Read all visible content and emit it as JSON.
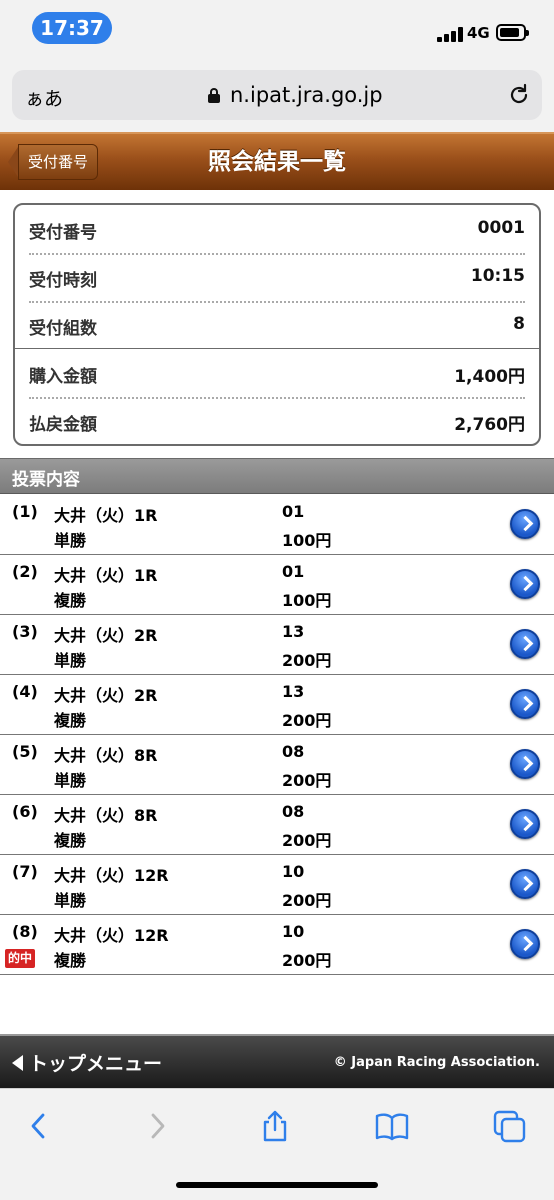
{
  "status_bar": {
    "time": "17:37",
    "network": "4G",
    "battery_level": 0.85
  },
  "browser": {
    "aa_label": "ぁあ",
    "domain": "n.ipat.jra.go.jp"
  },
  "header": {
    "back_label": "受付番号",
    "title": "照会結果一覧"
  },
  "summary": {
    "rows": [
      {
        "label": "受付番号",
        "value": "0001"
      },
      {
        "label": "受付時刻",
        "value": "10:15"
      },
      {
        "label": "受付組数",
        "value": "8"
      },
      {
        "label": "購入金額",
        "value": "1,400円"
      },
      {
        "label": "払戻金額",
        "value": "2,760円"
      }
    ]
  },
  "section": {
    "title": "投票内容"
  },
  "bets": [
    {
      "num": "(1)",
      "race": "大井（火）1R",
      "type": "単勝",
      "selection": "01",
      "amount": "100円",
      "hit": ""
    },
    {
      "num": "(2)",
      "race": "大井（火）1R",
      "type": "複勝",
      "selection": "01",
      "amount": "100円",
      "hit": ""
    },
    {
      "num": "(3)",
      "race": "大井（火）2R",
      "type": "単勝",
      "selection": "13",
      "amount": "200円",
      "hit": ""
    },
    {
      "num": "(4)",
      "race": "大井（火）2R",
      "type": "複勝",
      "selection": "13",
      "amount": "200円",
      "hit": ""
    },
    {
      "num": "(5)",
      "race": "大井（火）8R",
      "type": "単勝",
      "selection": "08",
      "amount": "200円",
      "hit": ""
    },
    {
      "num": "(6)",
      "race": "大井（火）8R",
      "type": "複勝",
      "selection": "08",
      "amount": "200円",
      "hit": ""
    },
    {
      "num": "(7)",
      "race": "大井（火）12R",
      "type": "単勝",
      "selection": "10",
      "amount": "200円",
      "hit": ""
    },
    {
      "num": "(8)",
      "race": "大井（火）12R",
      "type": "複勝",
      "selection": "10",
      "amount": "200円",
      "hit": "的中"
    }
  ],
  "footer": {
    "top_menu": "トップメニュー",
    "copyright": "© Japan Racing Association."
  },
  "icons": {
    "back": "chevron-left-icon",
    "forward": "chevron-right-icon",
    "share": "share-icon",
    "bookmarks": "book-icon",
    "tabs": "tabs-icon",
    "detail": "chevron-circle-right-icon"
  }
}
